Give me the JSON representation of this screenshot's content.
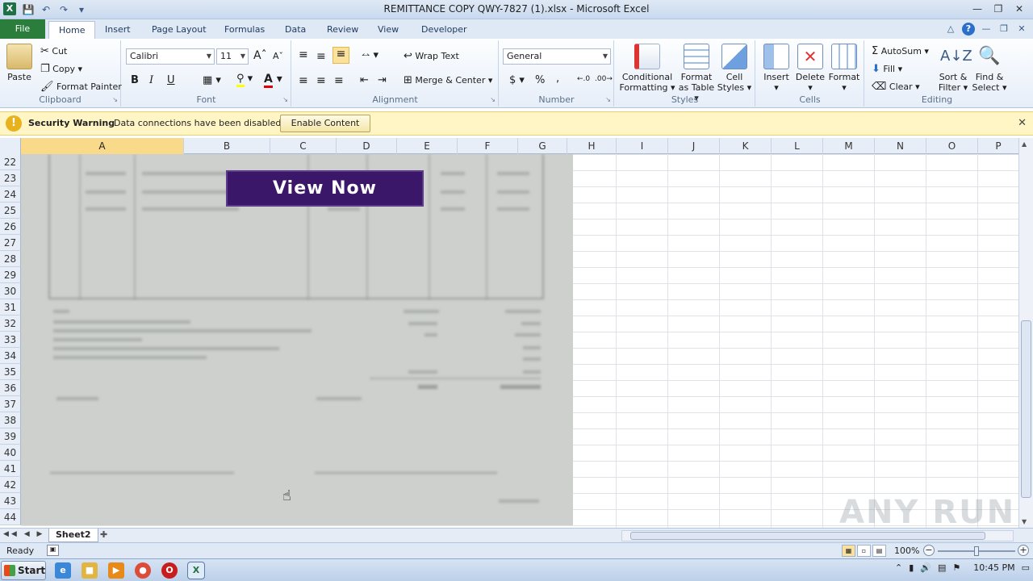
{
  "window": {
    "title": "REMITTANCE COPY QWY-7827 (1).xlsx - Microsoft Excel",
    "app_icon": "X"
  },
  "tabs": [
    "File",
    "Home",
    "Insert",
    "Page Layout",
    "Formulas",
    "Data",
    "Review",
    "View",
    "Developer"
  ],
  "ribbon": {
    "clipboard": {
      "paste": "Paste",
      "cut": "Cut",
      "copy": "Copy",
      "format_painter": "Format Painter",
      "label": "Clipboard"
    },
    "font": {
      "name": "Calibri",
      "size": "11",
      "bold": "B",
      "italic": "I",
      "underline": "U",
      "label": "Font"
    },
    "alignment": {
      "wrap_text": "Wrap Text",
      "merge_center": "Merge & Center",
      "label": "Alignment"
    },
    "number": {
      "format": "General",
      "currency": "$",
      "percent": "%",
      "comma": ",",
      "label": "Number"
    },
    "styles": {
      "conditional": "Conditional",
      "conditional2": "Formatting",
      "format_as": "Format",
      "format_as2": "as Table",
      "cell": "Cell",
      "cell2": "Styles",
      "label": "Styles"
    },
    "cells": {
      "insert": "Insert",
      "delete": "Delete",
      "format": "Format",
      "label": "Cells"
    },
    "editing": {
      "autosum": "AutoSum",
      "fill": "Fill",
      "clear": "Clear",
      "sort": "Sort &",
      "sort2": "Filter",
      "find": "Find &",
      "find2": "Select",
      "label": "Editing"
    }
  },
  "security": {
    "title": "Security Warning",
    "message": "Data connections have been disabled",
    "button": "Enable Content"
  },
  "columns": [
    "A",
    "B",
    "C",
    "D",
    "E",
    "F",
    "G",
    "H",
    "I",
    "J",
    "K",
    "L",
    "M",
    "N",
    "O",
    "P"
  ],
  "rows": [
    "22",
    "23",
    "24",
    "25",
    "26",
    "27",
    "28",
    "29",
    "30",
    "31",
    "32",
    "33",
    "34",
    "35",
    "36",
    "37",
    "38",
    "39",
    "40",
    "41",
    "42",
    "43",
    "44"
  ],
  "image": {
    "button_text": "View Now"
  },
  "sheet": {
    "name": "Sheet2"
  },
  "status": {
    "ready": "Ready",
    "zoom": "100%"
  },
  "taskbar": {
    "start": "Start",
    "time": "10:45 PM"
  },
  "watermark": "ANY RUN"
}
